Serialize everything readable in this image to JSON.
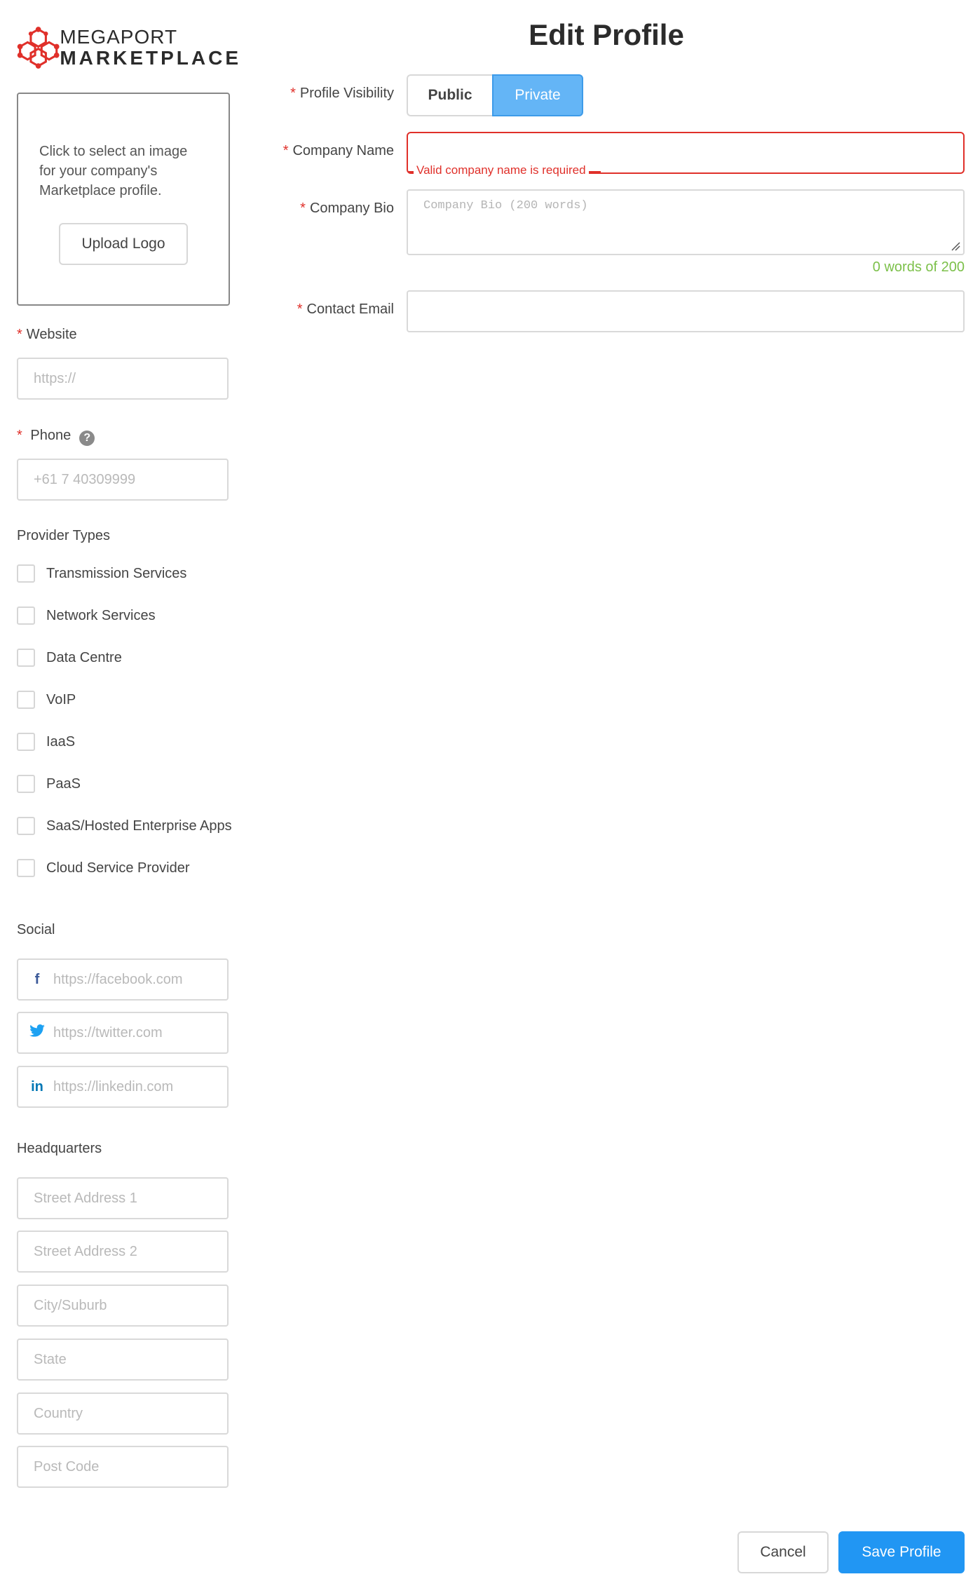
{
  "brand": {
    "line1": "MEGAPORT",
    "line2": "MARKETPLACE",
    "color": "#e0302a"
  },
  "page_title": "Edit Profile",
  "logo_upload": {
    "description": "Click to select an image for your company's Marketplace profile.",
    "button_label": "Upload Logo"
  },
  "website": {
    "label": "Website",
    "placeholder": "https://"
  },
  "phone": {
    "label": "Phone",
    "placeholder": "+61 7 40309999",
    "help_icon": "question-circle-icon"
  },
  "provider_types": {
    "heading": "Provider Types",
    "items": [
      "Transmission Services",
      "Network Services",
      "Data Centre",
      "VoIP",
      "IaaS",
      "PaaS",
      "SaaS/Hosted Enterprise Apps",
      "Cloud Service Provider"
    ]
  },
  "social": {
    "heading": "Social",
    "facebook": {
      "placeholder": "https://facebook.com",
      "icon": "facebook-icon",
      "color": "#3b5998"
    },
    "twitter": {
      "placeholder": "https://twitter.com",
      "icon": "twitter-icon",
      "color": "#1da1f2"
    },
    "linkedin": {
      "placeholder": "https://linkedin.com",
      "icon": "linkedin-icon",
      "color": "#0077b5"
    }
  },
  "headquarters": {
    "heading": "Headquarters",
    "street1": "Street Address 1",
    "street2": "Street Address 2",
    "city": "City/Suburb",
    "state": "State",
    "country": "Country",
    "postcode": "Post Code"
  },
  "profile_visibility": {
    "label": "Profile Visibility",
    "public": "Public",
    "private": "Private",
    "selected": "Private"
  },
  "company_name": {
    "label": "Company Name",
    "value": "",
    "error": "Valid company name is required"
  },
  "company_bio": {
    "label": "Company Bio",
    "placeholder": "Company Bio (200 words)",
    "word_count": "0 words of 200"
  },
  "contact_email": {
    "label": "Contact Email",
    "value": ""
  },
  "actions": {
    "cancel": "Cancel",
    "save": "Save Profile"
  }
}
